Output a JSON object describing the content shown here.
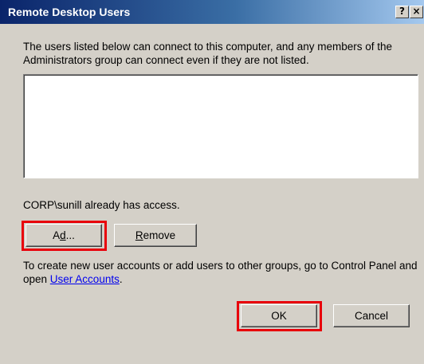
{
  "window": {
    "title": "Remote Desktop Users",
    "help_glyph": "?",
    "close_glyph": "×"
  },
  "description": "The users listed below can connect to this computer, and any members of the Administrators group can connect even if they are not listed.",
  "users_list": [],
  "access_note": "CORP\\sunill already has access.",
  "buttons": {
    "add_accesskey": "d",
    "add_rest": "...",
    "add_prefix": "A",
    "remove_accesskey": "R",
    "remove_rest": "emove",
    "ok": "OK",
    "cancel": "Cancel"
  },
  "info": {
    "text_before_link": "To create new user accounts or add users to other groups, go to Control Panel and open ",
    "link_text": "User Accounts",
    "text_after_link": "."
  },
  "colors": {
    "highlight": "#e8000b",
    "title_bar": "#0a246a",
    "dialog_face": "#d4d0c8"
  }
}
